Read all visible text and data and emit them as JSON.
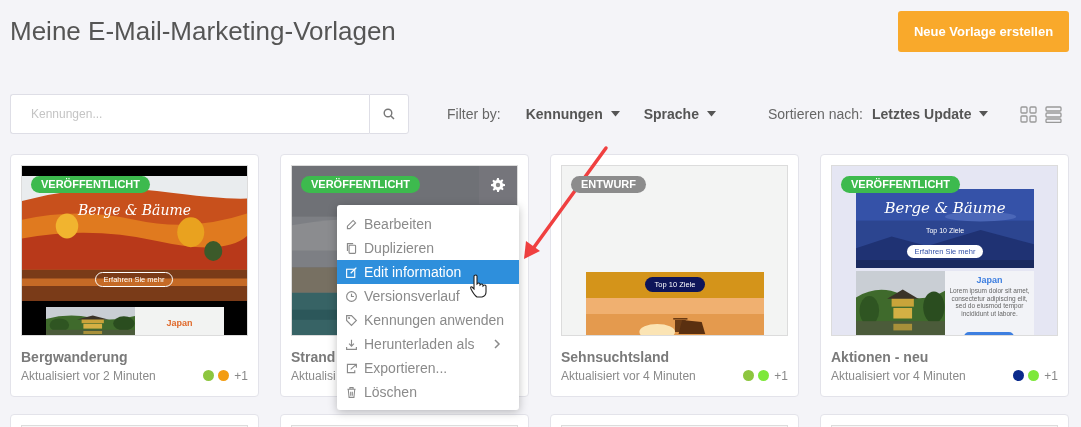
{
  "header": {
    "title": "Meine E-Mail-Marketing-Vorlagen",
    "create_button": "Neue Vorlage erstellen"
  },
  "toolbar": {
    "search": {
      "placeholder": "Kennungen..."
    },
    "filter_label": "Filter by:",
    "filters": [
      {
        "label": "Kennungen"
      },
      {
        "label": "Sprache"
      }
    ],
    "sort_label": "Sortieren nach:",
    "sort": {
      "label": "Letztes Update"
    },
    "views": [
      {
        "kind": "grid"
      },
      {
        "kind": "list"
      }
    ]
  },
  "templates": [
    {
      "name": "Bergwanderung",
      "updated": "Aktualisiert vor 2 Minuten",
      "status": {
        "kind": "published",
        "label": "VERÖFFENTLICHT"
      },
      "tags": [
        {
          "color": "#8dc63f"
        },
        {
          "color": "#f39c12"
        }
      ],
      "more_tags": "+1",
      "menu_open": false,
      "thumbnail": {
        "kind": "autumn",
        "heading": "Berge & Bäume",
        "button": "Erfahren Sie mehr",
        "side_heading": "Japan"
      }
    },
    {
      "name": "Strand",
      "updated": "Aktualisi",
      "status": {
        "kind": "published",
        "label": "VERÖFFENTLICHT"
      },
      "menu_open": true,
      "thumbnail": {
        "kind": "beach"
      }
    },
    {
      "name": "Sehnsuchtsland",
      "updated": "Aktualisiert vor 4 Minuten",
      "status": {
        "kind": "draft",
        "label": "ENTWURF"
      },
      "tags": [
        {
          "color": "#8dc63f"
        },
        {
          "color": "#7de83a"
        }
      ],
      "more_tags": "+1",
      "menu_open": false,
      "thumbnail": {
        "kind": "sunset",
        "button": "Top 10 Ziele"
      }
    },
    {
      "name": "Aktionen - neu",
      "updated": "Aktualisiert vor 4 Minuten",
      "status": {
        "kind": "published",
        "label": "VERÖFFENTLICHT"
      },
      "tags": [
        {
          "color": "#0a2a8c"
        },
        {
          "color": "#7de83a"
        }
      ],
      "more_tags": "+1",
      "menu_open": false,
      "thumbnail": {
        "kind": "travel",
        "heading": "Berge & Bäume",
        "subheading": "Top 10 Ziele",
        "button": "Erfahren Sie mehr",
        "side_heading": "Japan",
        "side_text": "Lorem ipsum dolor sit amet, consectetur adipiscing elit, sed do eiusmod tempor incididunt ut labore."
      }
    }
  ],
  "more_templates": [
    {
      "kind": "template"
    },
    {
      "kind": "template"
    },
    {
      "kind": "template"
    },
    {
      "kind": "template"
    }
  ],
  "context_menu": {
    "items": [
      {
        "kind": "pencil",
        "label": "Bearbeiten",
        "selected": false,
        "submenu": false
      },
      {
        "kind": "copy",
        "label": "Duplizieren",
        "selected": false,
        "submenu": false
      },
      {
        "kind": "edit",
        "label": "Edit information",
        "selected": true,
        "submenu": false
      },
      {
        "kind": "clock",
        "label": "Versionsverlauf",
        "selected": false,
        "submenu": false
      },
      {
        "kind": "tag",
        "label": "Kennungen anwenden",
        "selected": false,
        "submenu": false
      },
      {
        "kind": "download",
        "label": "Herunterladen als",
        "selected": false,
        "submenu": true
      },
      {
        "kind": "export",
        "label": "Exportieren...",
        "selected": false,
        "submenu": false
      },
      {
        "kind": "trash",
        "label": "Löschen",
        "selected": false,
        "submenu": false
      }
    ]
  },
  "annotation": {
    "kind": "arrow"
  },
  "cursor": {
    "kind": "hand"
  }
}
